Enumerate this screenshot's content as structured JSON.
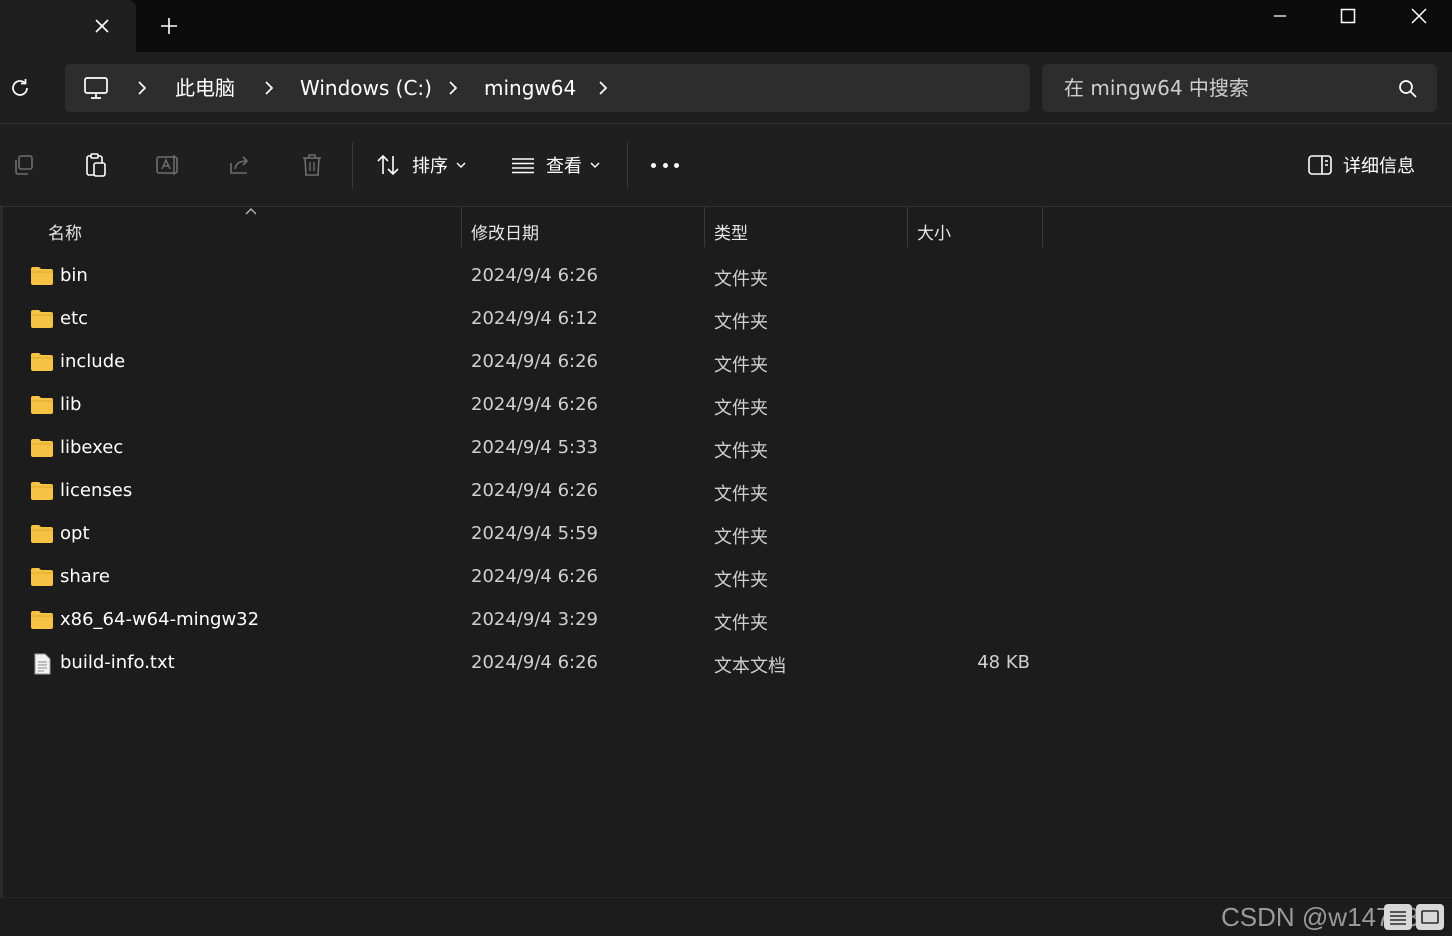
{
  "window": {
    "new_tab_label": "+"
  },
  "breadcrumb": {
    "items": [
      "此电脑",
      "Windows (C:)",
      "mingw64"
    ]
  },
  "search": {
    "placeholder": "在 mingw64 中搜索"
  },
  "toolbar": {
    "sort_label": "排序",
    "view_label": "查看",
    "details_label": "详细信息"
  },
  "columns": {
    "name": "名称",
    "date": "修改日期",
    "type": "类型",
    "size": "大小"
  },
  "files": [
    {
      "name": "bin",
      "date": "2024/9/4 6:26",
      "type": "文件夹",
      "size": "",
      "kind": "folder"
    },
    {
      "name": "etc",
      "date": "2024/9/4 6:12",
      "type": "文件夹",
      "size": "",
      "kind": "folder"
    },
    {
      "name": "include",
      "date": "2024/9/4 6:26",
      "type": "文件夹",
      "size": "",
      "kind": "folder"
    },
    {
      "name": "lib",
      "date": "2024/9/4 6:26",
      "type": "文件夹",
      "size": "",
      "kind": "folder"
    },
    {
      "name": "libexec",
      "date": "2024/9/4 5:33",
      "type": "文件夹",
      "size": "",
      "kind": "folder"
    },
    {
      "name": "licenses",
      "date": "2024/9/4 6:26",
      "type": "文件夹",
      "size": "",
      "kind": "folder"
    },
    {
      "name": "opt",
      "date": "2024/9/4 5:59",
      "type": "文件夹",
      "size": "",
      "kind": "folder"
    },
    {
      "name": "share",
      "date": "2024/9/4 6:26",
      "type": "文件夹",
      "size": "",
      "kind": "folder"
    },
    {
      "name": "x86_64-w64-mingw32",
      "date": "2024/9/4 3:29",
      "type": "文件夹",
      "size": "",
      "kind": "folder"
    },
    {
      "name": "build-info.txt",
      "date": "2024/9/4 6:26",
      "type": "文本文档",
      "size": "48 KB",
      "kind": "text-file"
    }
  ],
  "watermark": "CSDN @w147283",
  "colors": {
    "folder": "#f5c243",
    "accent": "#ffffff"
  }
}
